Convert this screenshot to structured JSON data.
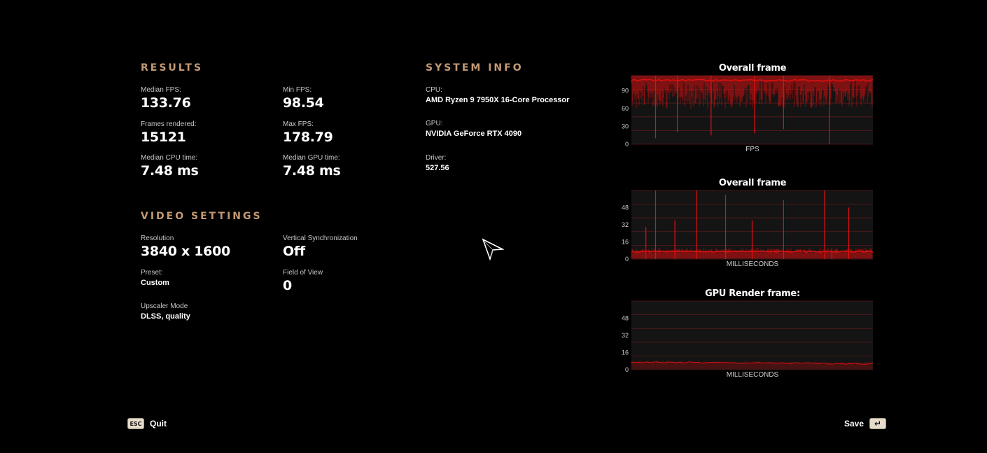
{
  "results": {
    "title": "RESULTS",
    "stats": [
      {
        "label": "Median FPS:",
        "value": "133.76"
      },
      {
        "label": "Min FPS:",
        "value": "98.54"
      },
      {
        "label": "Frames rendered:",
        "value": "15121"
      },
      {
        "label": "Max FPS:",
        "value": "178.79"
      },
      {
        "label": "Median CPU time:",
        "value": "7.48 ms"
      },
      {
        "label": "Median GPU time:",
        "value": "7.48 ms"
      }
    ]
  },
  "video_settings": {
    "title": "VIDEO SETTINGS",
    "items": [
      {
        "label": "Resolution",
        "value": "3840 x 1600"
      },
      {
        "label": "Vertical Synchronization",
        "value": "Off"
      },
      {
        "label": "Preset:",
        "value": "Custom"
      },
      {
        "label": "Field of View",
        "value": "0"
      },
      {
        "label": "Upscaler Mode",
        "value": "DLSS, quality"
      }
    ]
  },
  "system_info": {
    "title": "SYSTEM INFO",
    "items": [
      {
        "label": "CPU:",
        "value": "AMD Ryzen 9 7950X 16-Core Processor"
      },
      {
        "label": "GPU:",
        "value": "NVIDIA GeForce RTX 4090"
      },
      {
        "label": "Driver:",
        "value": "527.56"
      }
    ]
  },
  "footer": {
    "quit_key": "ESC",
    "quit_label": "Quit",
    "save_label": "Save",
    "save_key": "↵"
  },
  "colors": {
    "accent": "#c49a74",
    "series": "#e01010",
    "grid": "#5a1a1a",
    "plot_bg": "#141414"
  },
  "chart_data": [
    {
      "type": "line",
      "title": "Overall frame",
      "xlabel": "FPS",
      "ylabel": "",
      "ylim": [
        0,
        115
      ],
      "yticks": [
        0,
        30,
        60,
        90
      ],
      "series": [
        {
          "baseline": 107,
          "noise_min": 60,
          "noise_max": 115,
          "spikes": [
            {
              "pos": 0.1,
              "v": 10
            },
            {
              "pos": 0.19,
              "v": 20
            },
            {
              "pos": 0.33,
              "v": 15
            },
            {
              "pos": 0.51,
              "v": 18
            },
            {
              "pos": 0.63,
              "v": 25
            },
            {
              "pos": 0.82,
              "v": 0
            }
          ]
        }
      ]
    },
    {
      "type": "line",
      "title": "Overall frame",
      "xlabel": "MILLISECONDS",
      "ylabel": "",
      "ylim": [
        0,
        64
      ],
      "yticks": [
        0,
        16,
        32,
        48
      ],
      "series": [
        {
          "baseline": 7,
          "noise_min": 5,
          "noise_max": 10,
          "spikes": [
            {
              "pos": 0.1,
              "v": 64
            },
            {
              "pos": 0.06,
              "v": 30
            },
            {
              "pos": 0.18,
              "v": 36
            },
            {
              "pos": 0.27,
              "v": 64
            },
            {
              "pos": 0.39,
              "v": 60
            },
            {
              "pos": 0.5,
              "v": 36
            },
            {
              "pos": 0.63,
              "v": 55
            },
            {
              "pos": 0.8,
              "v": 64
            },
            {
              "pos": 0.83,
              "v": 10
            },
            {
              "pos": 0.9,
              "v": 48
            }
          ]
        }
      ]
    },
    {
      "type": "line",
      "title": "GPU Render frame:",
      "xlabel": "MILLISECONDS",
      "ylabel": "",
      "ylim": [
        0,
        64
      ],
      "yticks": [
        0,
        16,
        32,
        48
      ],
      "series": [
        {
          "baseline": 7,
          "end_baseline": 5.5,
          "noise_min": 6,
          "noise_max": 8.5,
          "spikes": []
        }
      ]
    }
  ]
}
